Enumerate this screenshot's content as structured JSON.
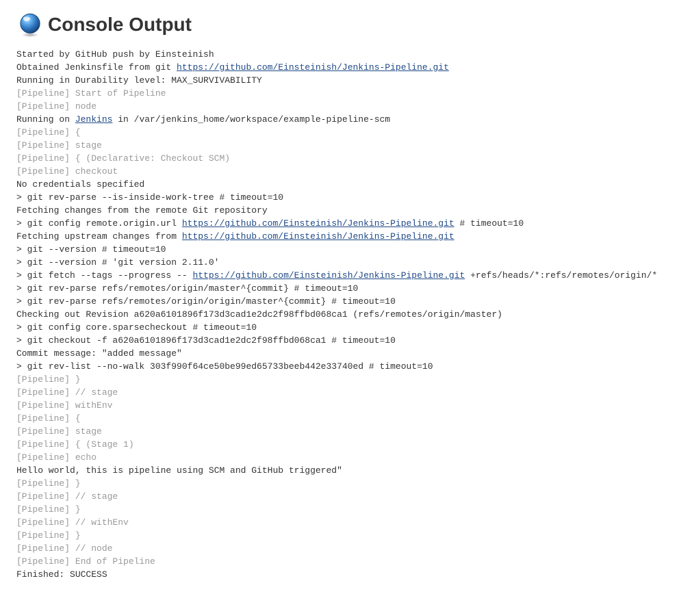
{
  "header": {
    "title": "Console Output"
  },
  "repo_url": "https://github.com/Einsteinish/Jenkins-Pipeline.git",
  "jenkins_label": "Jenkins",
  "lines": [
    {
      "type": "plain",
      "text": "Started by GitHub push by Einsteinish"
    },
    {
      "type": "link_line",
      "prefix": "Obtained Jenkinsfile from git ",
      "link": "https://github.com/Einsteinish/Jenkins-Pipeline.git",
      "suffix": ""
    },
    {
      "type": "plain",
      "text": "Running in Durability level: MAX_SURVIVABILITY"
    },
    {
      "type": "pipeline",
      "text": "[Pipeline] Start of Pipeline"
    },
    {
      "type": "pipeline",
      "text": "[Pipeline] node"
    },
    {
      "type": "jenkins_line",
      "prefix": "Running on ",
      "link": "Jenkins",
      "suffix": " in /var/jenkins_home/workspace/example-pipeline-scm"
    },
    {
      "type": "pipeline",
      "text": "[Pipeline] {"
    },
    {
      "type": "pipeline",
      "text": "[Pipeline] stage"
    },
    {
      "type": "pipeline",
      "text": "[Pipeline] { (Declarative: Checkout SCM)"
    },
    {
      "type": "pipeline",
      "text": "[Pipeline] checkout"
    },
    {
      "type": "plain",
      "text": "No credentials specified"
    },
    {
      "type": "plain",
      "text": " > git rev-parse --is-inside-work-tree # timeout=10"
    },
    {
      "type": "plain",
      "text": "Fetching changes from the remote Git repository"
    },
    {
      "type": "link_line",
      "prefix": " > git config remote.origin.url ",
      "link": "https://github.com/Einsteinish/Jenkins-Pipeline.git",
      "suffix": " # timeout=10"
    },
    {
      "type": "link_line",
      "prefix": "Fetching upstream changes from ",
      "link": "https://github.com/Einsteinish/Jenkins-Pipeline.git",
      "suffix": ""
    },
    {
      "type": "plain",
      "text": " > git --version # timeout=10"
    },
    {
      "type": "plain",
      "text": " > git --version # 'git version 2.11.0'"
    },
    {
      "type": "link_line",
      "prefix": " > git fetch --tags --progress -- ",
      "link": "https://github.com/Einsteinish/Jenkins-Pipeline.git",
      "suffix": " +refs/heads/*:refs/remotes/origin/*"
    },
    {
      "type": "plain",
      "text": " > git rev-parse refs/remotes/origin/master^{commit} # timeout=10"
    },
    {
      "type": "plain",
      "text": " > git rev-parse refs/remotes/origin/origin/master^{commit} # timeout=10"
    },
    {
      "type": "plain",
      "text": "Checking out Revision a620a6101896f173d3cad1e2dc2f98ffbd068ca1 (refs/remotes/origin/master)"
    },
    {
      "type": "plain",
      "text": " > git config core.sparsecheckout # timeout=10"
    },
    {
      "type": "plain",
      "text": " > git checkout -f a620a6101896f173d3cad1e2dc2f98ffbd068ca1 # timeout=10"
    },
    {
      "type": "plain",
      "text": "Commit message: \"added message\""
    },
    {
      "type": "plain",
      "text": " > git rev-list --no-walk 303f990f64ce50be99ed65733beeb442e33740ed # timeout=10"
    },
    {
      "type": "pipeline",
      "text": "[Pipeline] }"
    },
    {
      "type": "pipeline",
      "text": "[Pipeline] // stage"
    },
    {
      "type": "pipeline",
      "text": "[Pipeline] withEnv"
    },
    {
      "type": "pipeline",
      "text": "[Pipeline] {"
    },
    {
      "type": "pipeline",
      "text": "[Pipeline] stage"
    },
    {
      "type": "pipeline",
      "text": "[Pipeline] { (Stage 1)"
    },
    {
      "type": "pipeline",
      "text": "[Pipeline] echo"
    },
    {
      "type": "plain",
      "text": "Hello world, this is pipeline using SCM and GitHub triggered\""
    },
    {
      "type": "pipeline",
      "text": "[Pipeline] }"
    },
    {
      "type": "pipeline",
      "text": "[Pipeline] // stage"
    },
    {
      "type": "pipeline",
      "text": "[Pipeline] }"
    },
    {
      "type": "pipeline",
      "text": "[Pipeline] // withEnv"
    },
    {
      "type": "pipeline",
      "text": "[Pipeline] }"
    },
    {
      "type": "pipeline",
      "text": "[Pipeline] // node"
    },
    {
      "type": "pipeline",
      "text": "[Pipeline] End of Pipeline"
    },
    {
      "type": "plain",
      "text": "Finished: SUCCESS"
    }
  ]
}
